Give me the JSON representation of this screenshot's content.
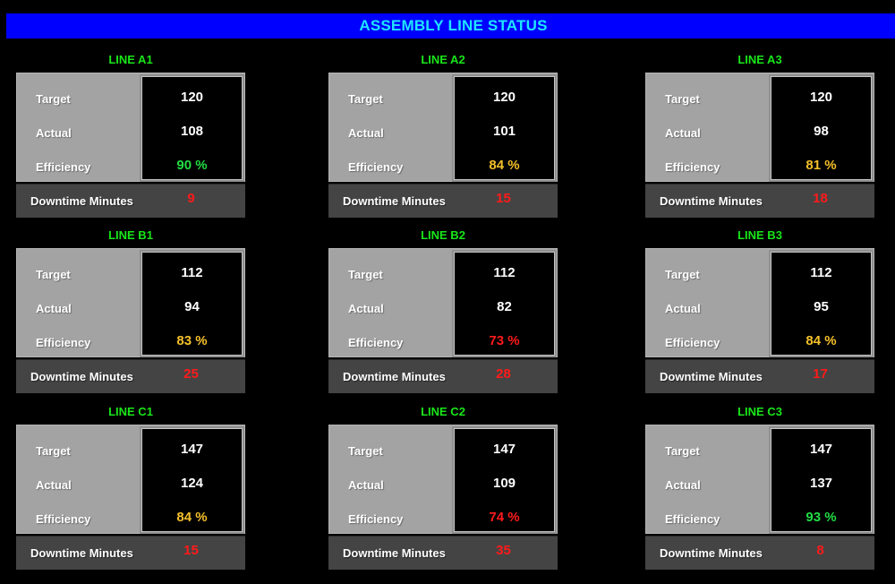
{
  "header": {
    "title": "ASSEMBLY LINE STATUS"
  },
  "colors": {
    "header_bg": "#0000ff",
    "header_text": "#1ee6ff",
    "panel_title": "#19e619",
    "efficiency_good": "#22dd44",
    "efficiency_warn": "#f5c02a",
    "efficiency_bad": "#ff1a1a",
    "downtime_value": "#ff1a1a"
  },
  "labels": {
    "target": "Target",
    "actual": "Actual",
    "efficiency": "Efficiency",
    "downtime": "Downtime Minutes"
  },
  "lines": [
    {
      "name": "LINE A1",
      "target": "120",
      "actual": "108",
      "efficiency": "90 %",
      "efficiency_status": "good",
      "downtime": "9"
    },
    {
      "name": "LINE A2",
      "target": "120",
      "actual": "101",
      "efficiency": "84 %",
      "efficiency_status": "warn",
      "downtime": "15"
    },
    {
      "name": "LINE A3",
      "target": "120",
      "actual": "98",
      "efficiency": "81 %",
      "efficiency_status": "warn",
      "downtime": "18"
    },
    {
      "name": "LINE B1",
      "target": "112",
      "actual": "94",
      "efficiency": "83 %",
      "efficiency_status": "warn",
      "downtime": "25"
    },
    {
      "name": "LINE B2",
      "target": "112",
      "actual": "82",
      "efficiency": "73 %",
      "efficiency_status": "bad",
      "downtime": "28"
    },
    {
      "name": "LINE B3",
      "target": "112",
      "actual": "95",
      "efficiency": "84 %",
      "efficiency_status": "warn",
      "downtime": "17"
    },
    {
      "name": "LINE C1",
      "target": "147",
      "actual": "124",
      "efficiency": "84 %",
      "efficiency_status": "warn",
      "downtime": "15"
    },
    {
      "name": "LINE C2",
      "target": "147",
      "actual": "109",
      "efficiency": "74 %",
      "efficiency_status": "bad",
      "downtime": "35"
    },
    {
      "name": "LINE C3",
      "target": "147",
      "actual": "137",
      "efficiency": "93 %",
      "efficiency_status": "good",
      "downtime": "8"
    }
  ]
}
